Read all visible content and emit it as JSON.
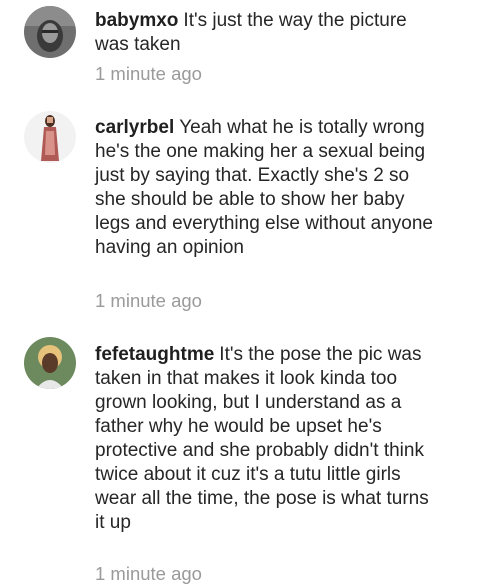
{
  "comments": [
    {
      "username": "babymxo",
      "text": "It's just the way the picture was taken",
      "time": "1 minute ago",
      "avatar_icon": "user-avatar-photo"
    },
    {
      "username": "carlyrbel",
      "text": "Yeah what he is totally wrong he's the one making her a sexual being just by saying that. Exactly she's 2 so she should be able to show her baby legs and everything else without anyone having an opinion",
      "time": "1 minute ago",
      "avatar_icon": "user-avatar-photo"
    },
    {
      "username": "fefetaughtme",
      "text": "It's the pose the pic was taken in that makes it look kinda too grown looking, but I understand as a father why he would be upset he's protective and she probably didn't think twice about it cuz it's a tutu little girls wear all the time, the pose is what turns it up",
      "time": "1 minute ago",
      "avatar_icon": "user-avatar-photo"
    }
  ],
  "colors": {
    "username": "#1f1f1f",
    "text": "#262626",
    "timestamp": "#9a9a9a",
    "background": "#ffffff"
  }
}
